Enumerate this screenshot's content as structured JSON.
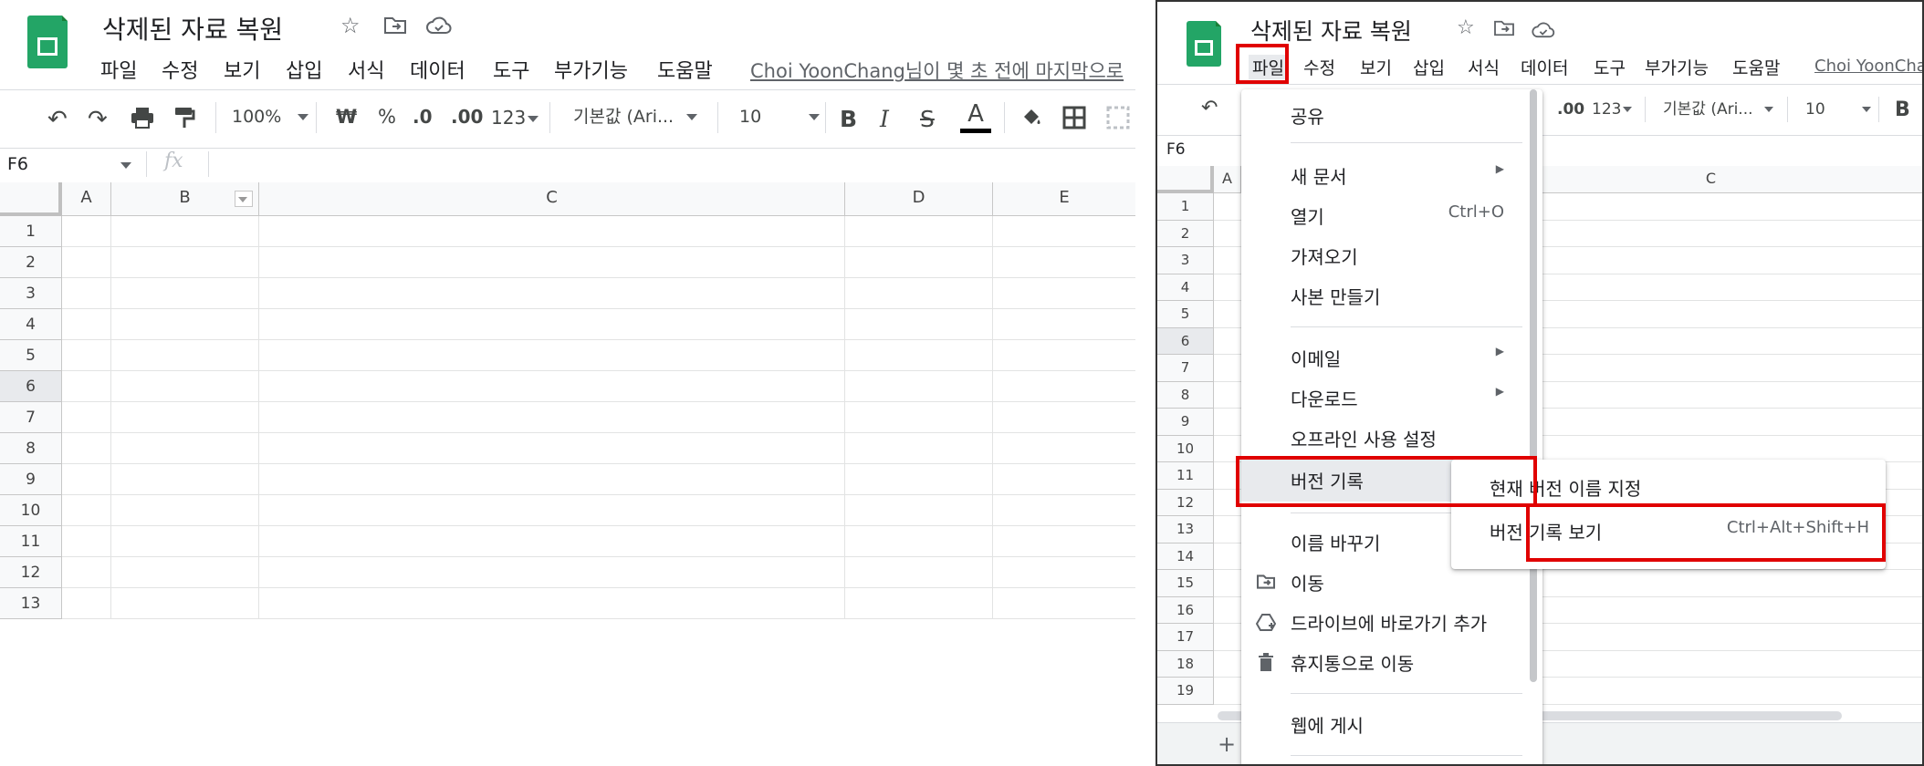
{
  "left": {
    "title": "삭제된 자료 복원",
    "menu": [
      "파일",
      "수정",
      "보기",
      "삽입",
      "서식",
      "데이터",
      "도구",
      "부가기능",
      "도움말"
    ],
    "last_edit_link": "Choi YoonChang",
    "last_edit_rest": "님이 몇 초 전에 마지막으로",
    "zoom": "100%",
    "currency": "₩",
    "percent": "%",
    "dec_less": ".0",
    "dec_more": ".00",
    "more_formats": "123",
    "font": "기본값 (Ari...",
    "font_size": "10",
    "bold": "B",
    "italic": "I",
    "strike": "S",
    "text_color": "A",
    "cell_ref": "F6",
    "fx": "fx",
    "columns": [
      "A",
      "B",
      "C",
      "D",
      "E"
    ],
    "rows": [
      "1",
      "2",
      "3",
      "4",
      "5",
      "6",
      "7",
      "8",
      "9",
      "10",
      "11",
      "12",
      "13"
    ]
  },
  "right": {
    "title": "삭제된 자료 복원",
    "menu": [
      "파일",
      "수정",
      "보기",
      "삽입",
      "서식",
      "데이터",
      "도구",
      "부가기능",
      "도움말"
    ],
    "last_edit_link": "Choi YoonChang",
    "more_formats": "123",
    "dec_more": ".00",
    "font": "기본값 (Ari...",
    "font_size": "10",
    "bold": "B",
    "cell_ref": "F6",
    "col_a": "A",
    "col_c": "C",
    "rows": [
      "1",
      "2",
      "3",
      "4",
      "5",
      "6",
      "7",
      "8",
      "9",
      "10",
      "11",
      "12",
      "13",
      "14",
      "15",
      "16",
      "17",
      "18",
      "19"
    ],
    "add_sheet": "+",
    "file_menu": {
      "share": "공유",
      "new": "새 문서",
      "open": "열기",
      "open_shortcut": "Ctrl+O",
      "import": "가져오기",
      "copy": "사본 만들기",
      "email": "이메일",
      "download": "다운로드",
      "offline": "오프라인 사용 설정",
      "version_history": "버전 기록",
      "rename": "이름 바꾸기",
      "move": "이동",
      "add_shortcut": "드라이브에 바로가기 추가",
      "trash": "휴지통으로 이동",
      "publish": "웹에 게시"
    },
    "version_submenu": {
      "name_current": "현재 버전 이름 지정",
      "see_history": "버전 기록 보기",
      "see_history_shortcut": "Ctrl+Alt+Shift+H"
    }
  },
  "colors": {
    "highlight": "#e00000",
    "sheets_green": "#23a566"
  }
}
